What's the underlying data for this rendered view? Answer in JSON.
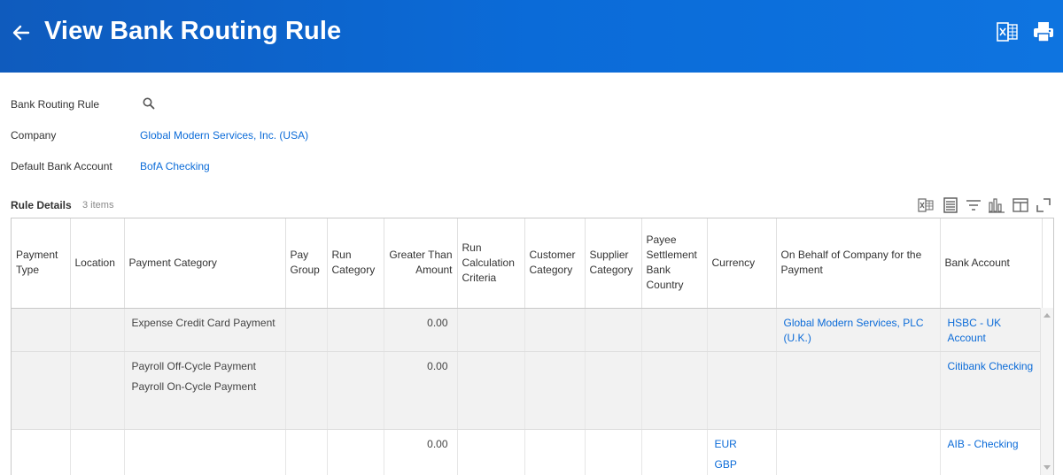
{
  "header": {
    "title": "View Bank Routing Rule",
    "accent_color": "#0b6bd8",
    "icons": {
      "back": "arrow-left-icon",
      "excel": "excel-export-icon",
      "print": "printer-icon"
    }
  },
  "fields": {
    "bank_routing_rule": {
      "label": "Bank Routing Rule",
      "icon": "search-icon"
    },
    "company": {
      "label": "Company",
      "value": "Global Modern Services, Inc. (USA)"
    },
    "default_bank_account": {
      "label": "Default Bank Account",
      "value": "BofA Checking"
    }
  },
  "rule_details": {
    "title": "Rule Details",
    "count": "3 items",
    "toolbar_icons": [
      "excel-export-icon",
      "table-view-icon",
      "filter-icon",
      "chart-icon",
      "columns-icon",
      "fullscreen-icon"
    ],
    "columns": [
      "Payment Type",
      "Location",
      "Payment Category",
      "Pay Group",
      "Run Category",
      "Greater Than Amount",
      "Run Calculation Criteria",
      "Customer Category",
      "Supplier Category",
      "Payee Settlement Bank Country",
      "Currency",
      "On Behalf of Company for the Payment",
      "Bank Account"
    ],
    "rows": [
      {
        "payment_type": "",
        "location": "",
        "payment_category": [
          "Expense Credit Card Payment"
        ],
        "pay_group": "",
        "run_category": "",
        "greater_than_amount": "0.00",
        "run_calculation_criteria": "",
        "customer_category": "",
        "supplier_category": "",
        "payee_settlement_bank_country": "",
        "currency": [],
        "on_behalf_of_company": "Global Modern Services, PLC (U.K.)",
        "bank_account": "HSBC - UK Account"
      },
      {
        "payment_type": "",
        "location": "",
        "payment_category": [
          "Payroll Off-Cycle Payment",
          "Payroll On-Cycle Payment"
        ],
        "pay_group": "",
        "run_category": "",
        "greater_than_amount": "0.00",
        "run_calculation_criteria": "",
        "customer_category": "",
        "supplier_category": "",
        "payee_settlement_bank_country": "",
        "currency": [],
        "on_behalf_of_company": "",
        "bank_account": "Citibank Checking"
      },
      {
        "payment_type": "",
        "location": "",
        "payment_category": [],
        "pay_group": "",
        "run_category": "",
        "greater_than_amount": "0.00",
        "run_calculation_criteria": "",
        "customer_category": "",
        "supplier_category": "",
        "payee_settlement_bank_country": "",
        "currency": [
          "EUR",
          "GBP"
        ],
        "on_behalf_of_company": "",
        "bank_account": "AIB - Checking"
      }
    ]
  }
}
